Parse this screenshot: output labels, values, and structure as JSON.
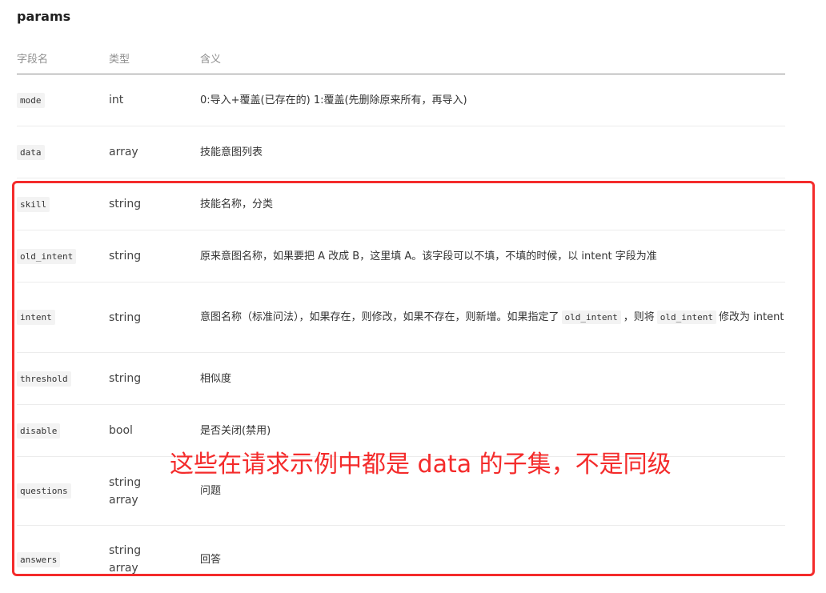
{
  "section": {
    "title": "params"
  },
  "table": {
    "headers": {
      "name": "字段名",
      "type": "类型",
      "desc": "含义"
    },
    "rows": [
      {
        "name": "mode",
        "type": "int",
        "desc": "0:导入+覆盖(已存在的) 1:覆盖(先删除原来所有，再导入)"
      },
      {
        "name": "data",
        "type": "array",
        "desc": "技能意图列表"
      },
      {
        "name": "skill",
        "type": "string",
        "desc": "技能名称，分类"
      },
      {
        "name": "old_intent",
        "type": "string",
        "desc": "原来意图名称，如果要把 A 改成 B，这里填 A。该字段可以不填，不填的时候，以 intent 字段为准"
      },
      {
        "name": "intent",
        "type": "string",
        "desc_part1": "意图名称（标准问法），如果存在，则修改，如果不存在，则新增。如果指定了",
        "desc_code1": "old_intent",
        "desc_part2": "，则将",
        "desc_code2": "old_intent",
        "desc_part3": "修改为 intent"
      },
      {
        "name": "threshold",
        "type": "string",
        "desc": "相似度"
      },
      {
        "name": "disable",
        "type": "bool",
        "desc": "是否关闭(禁用)"
      },
      {
        "name": "questions",
        "type_line1": "string",
        "type_line2": "array",
        "desc": "问题"
      },
      {
        "name": "answers",
        "type_line1": "string",
        "type_line2": "array",
        "desc": "回答"
      }
    ]
  },
  "annotation": {
    "text": "这些在请求示例中都是 data 的子集，不是同级",
    "color": "#f42b2b"
  }
}
